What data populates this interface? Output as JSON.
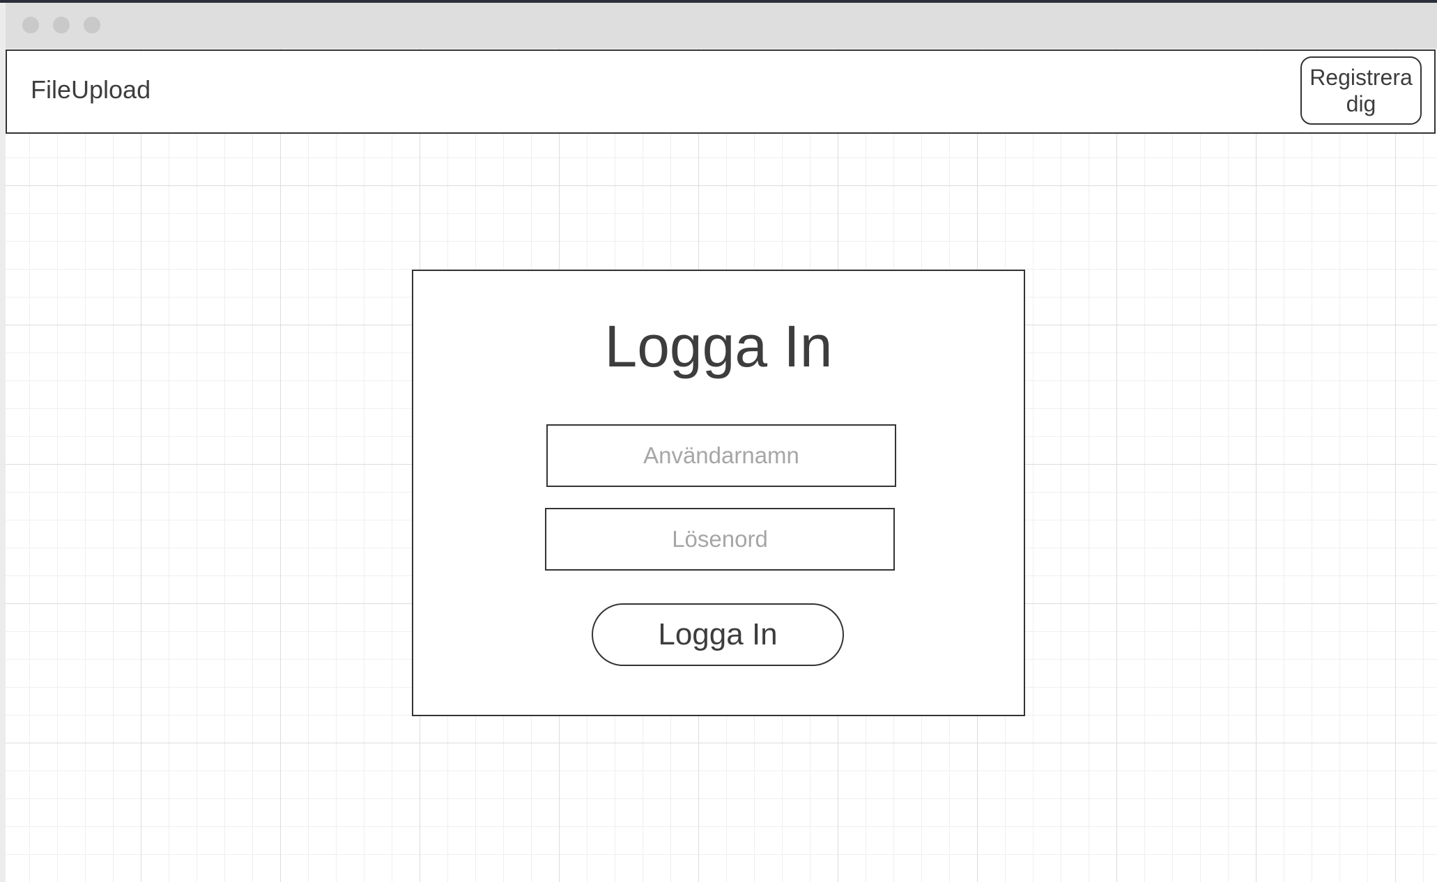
{
  "app": {
    "brand": "FileUpload"
  },
  "navbar": {
    "register_label": "Registrera dig"
  },
  "login": {
    "title": "Logga In",
    "username_placeholder": "Användarnamn",
    "username_value": "",
    "password_placeholder": "Lösenord",
    "password_value": "",
    "submit_label": "Logga In"
  },
  "colors": {
    "border": "#333333",
    "text": "#3d3d3d",
    "placeholder": "#a6a6a6",
    "titlebar": "#dedede",
    "grid_major": "#dcdcdc",
    "grid_minor": "#efefef"
  }
}
